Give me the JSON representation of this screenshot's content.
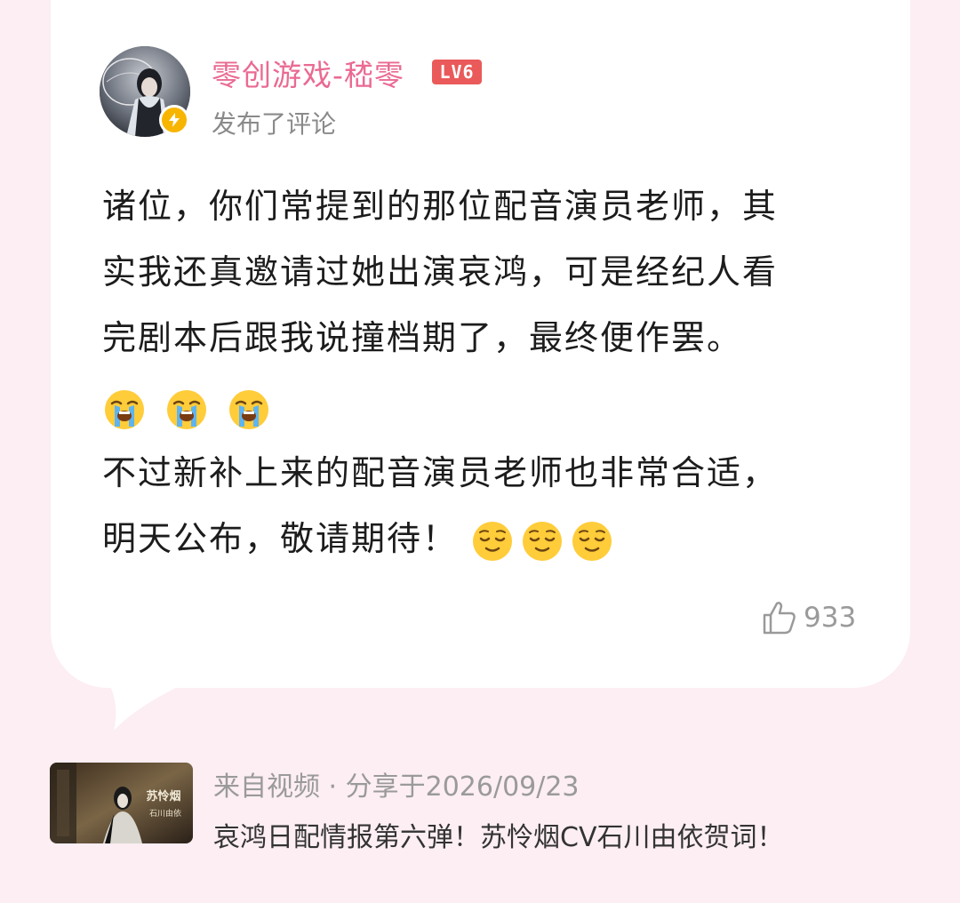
{
  "comment": {
    "username": "零创游戏-嵇零",
    "level_badge": "LV6",
    "action": "发布了评论",
    "text_lines": [
      "诸位，你们常提到的那位配音演员老师，其",
      "实我还真邀请过她出演哀鸿，可是经纪人看",
      "完剧本后跟我说撞档期了，最终便作罢。"
    ],
    "emoji_row_1": [
      "loudly-crying-face",
      "loudly-crying-face",
      "loudly-crying-face"
    ],
    "text_lines_2": [
      "不过新补上来的配音演员老师也非常合适，",
      "明天公布，敬请期待！"
    ],
    "emoji_row_2": [
      "relieved-face",
      "relieved-face",
      "relieved-face"
    ],
    "like_count": "933"
  },
  "source": {
    "meta": "来自视频 · 分享于2026/09/23",
    "title": "哀鸿日配情报第六弹！苏怜烟CV石川由依贺词！",
    "thumbnail_text": "苏怜烟 石川由依"
  },
  "colors": {
    "background": "#fceef3",
    "username": "#ea6a92",
    "level_badge": "#ea5a5a",
    "verify_badge": "#f7b500"
  }
}
